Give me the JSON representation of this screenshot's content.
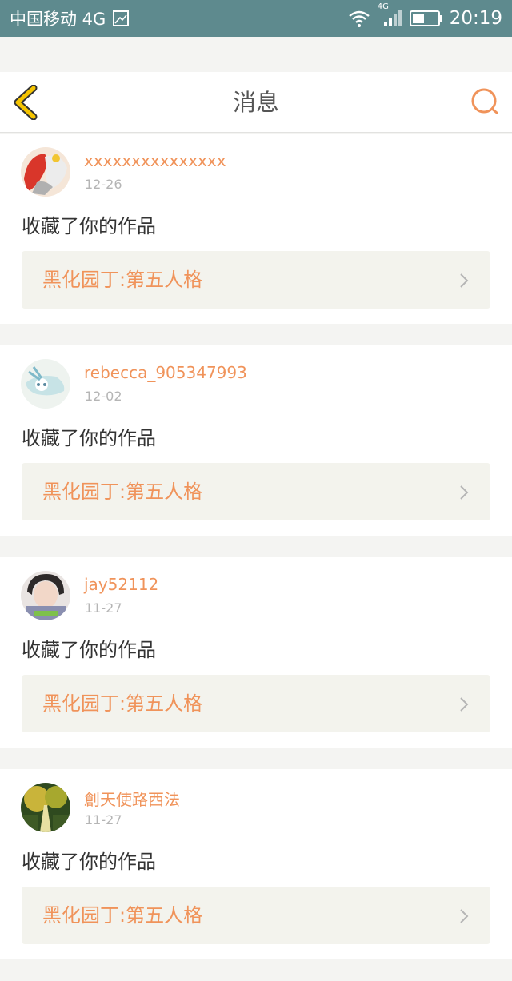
{
  "status_bar": {
    "carrier": "中国移动 4G",
    "network_label": "4G",
    "time": "20:19",
    "icons": [
      "image-icon",
      "wifi-icon",
      "signal-icon",
      "battery-icon"
    ]
  },
  "header": {
    "title": "消息",
    "back_icon": "chevron-left-icon",
    "search_icon": "search-icon"
  },
  "colors": {
    "accent_orange": "#f0935a",
    "back_yellow": "#f5c400",
    "status_bar_bg": "#5e8a8e",
    "work_bg": "#f3f3ed"
  },
  "messages": [
    {
      "username": "xxxxxxxxxxxxxxx",
      "date": "12-26",
      "action": "收藏了你的作品",
      "work_title": "黑化园丁:第五人格"
    },
    {
      "username": "rebecca_905347993",
      "date": "12-02",
      "action": "收藏了你的作品",
      "work_title": "黑化园丁:第五人格"
    },
    {
      "username": "jay52112",
      "date": "11-27",
      "action": "收藏了你的作品",
      "work_title": "黑化园丁:第五人格"
    },
    {
      "username": "創天使路西法",
      "date": "11-27",
      "action": "收藏了你的作品",
      "work_title": "黑化园丁:第五人格"
    }
  ]
}
